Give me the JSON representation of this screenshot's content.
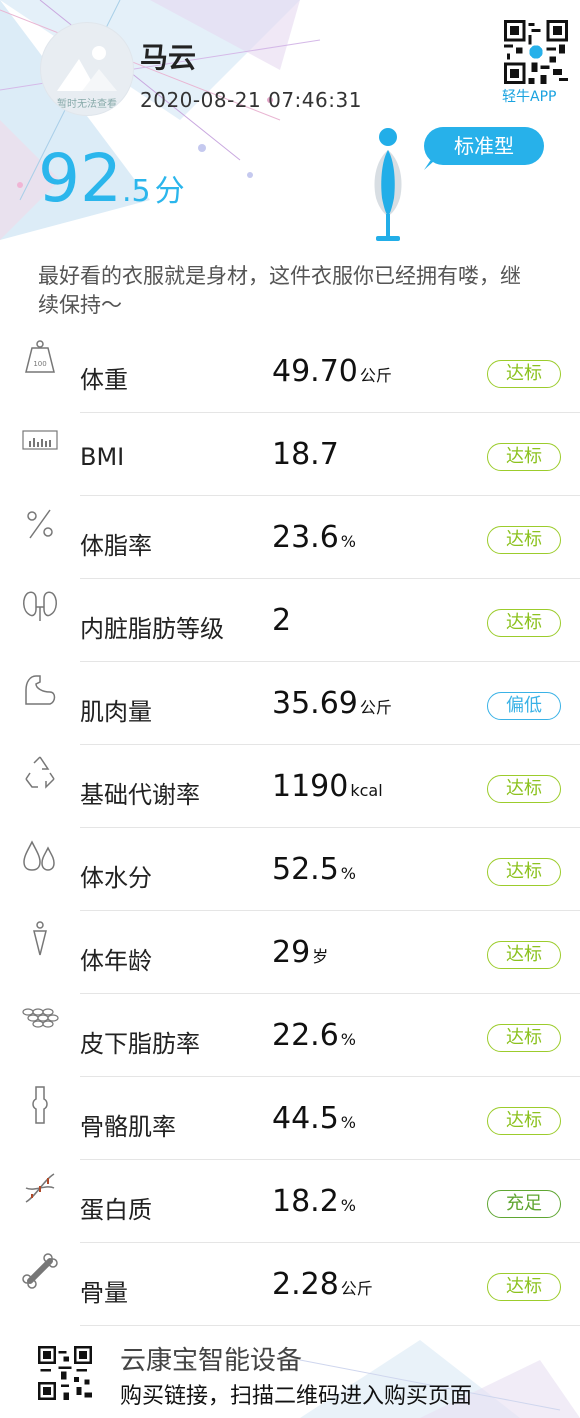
{
  "user": {
    "name": "马云",
    "timestamp": "2020-08-21 07:46:31",
    "avatar_text": "暂时无法查看"
  },
  "score": {
    "integer": "92",
    "decimal": ".5",
    "unit": "分"
  },
  "body_type": "标准型",
  "app": {
    "qr_label": "轻牛APP"
  },
  "tagline": "最好看的衣服就是身材，这件衣服你已经拥有喽，继续保持～",
  "metrics": [
    {
      "label": "体重",
      "value": "49.70",
      "unit": "公斤",
      "status": "达标",
      "icon": "weight-icon"
    },
    {
      "label": "BMI",
      "value": "18.7",
      "unit": "",
      "status": "达标",
      "icon": "bmi-chart-icon"
    },
    {
      "label": "体脂率",
      "value": "23.6",
      "unit": "%",
      "status": "达标",
      "icon": "percent-icon"
    },
    {
      "label": "内脏脂肪等级",
      "value": "2",
      "unit": "",
      "status": "达标",
      "icon": "organs-icon"
    },
    {
      "label": "肌肉量",
      "value": "35.69",
      "unit": "公斤",
      "status": "偏低",
      "icon": "muscle-arm-icon"
    },
    {
      "label": "基础代谢率",
      "value": "1190",
      "unit": "kcal",
      "status": "达标",
      "icon": "recycle-icon"
    },
    {
      "label": "体水分",
      "value": "52.5",
      "unit": "%",
      "status": "达标",
      "icon": "water-drops-icon"
    },
    {
      "label": "体年龄",
      "value": "29",
      "unit": "岁",
      "status": "达标",
      "icon": "person-icon"
    },
    {
      "label": "皮下脂肪率",
      "value": "22.6",
      "unit": "%",
      "status": "达标",
      "icon": "fat-cells-icon"
    },
    {
      "label": "骨骼肌率",
      "value": "44.5",
      "unit": "%",
      "status": "达标",
      "icon": "joint-bone-icon"
    },
    {
      "label": "蛋白质",
      "value": "18.2",
      "unit": "%",
      "status": "充足",
      "icon": "dna-icon"
    },
    {
      "label": "骨量",
      "value": "2.28",
      "unit": "公斤",
      "status": "达标",
      "icon": "bone-icon"
    }
  ],
  "footer": {
    "title": "云康宝智能设备",
    "subtitle": "购买链接，扫描二维码进入购买页面"
  },
  "colors": {
    "accent": "#2bb6ec",
    "standard": "#8cc21f",
    "low": "#3ab2e6",
    "sufficient": "#5fa632"
  }
}
